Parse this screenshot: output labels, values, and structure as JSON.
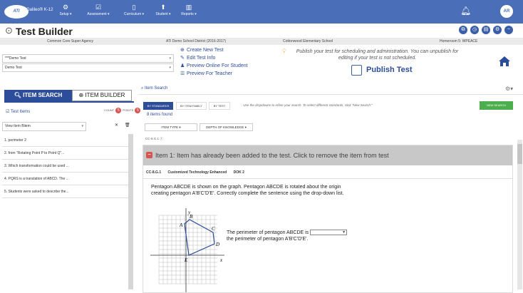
{
  "app": {
    "brand": "Galileo® K-12",
    "logo_text": "ATI",
    "nav": [
      {
        "label": "Setup ▾",
        "icon": "gear-icon",
        "glyph": "⚙"
      },
      {
        "label": "Assessment ▾",
        "icon": "clipboard-icon",
        "glyph": "☑"
      },
      {
        "label": "Curriculum ▾",
        "icon": "book-icon",
        "glyph": "▯"
      },
      {
        "label": "Student ▾",
        "icon": "student-icon",
        "glyph": "⬆"
      },
      {
        "label": "Reports ▾",
        "icon": "bar-chart-icon",
        "glyph": "▥"
      }
    ],
    "avatar": "AR",
    "accent": "#4a6eb8"
  },
  "page": {
    "title": "Test Builder",
    "header_icons": [
      "copy-icon",
      "history-icon",
      "print-icon",
      "settings-icon",
      "close-icon"
    ]
  },
  "context": {
    "agency": "Common Core Super Agency",
    "district": "ATI Demo School District (2016-2017)",
    "school": "Cottonwood Elementary School",
    "homeroom": "Homeroom 5: WPEACE"
  },
  "test": {
    "select1": "***Demo Test",
    "select2": "Demo Test",
    "actions": [
      {
        "label": "Create New Test",
        "glyph": "⊕"
      },
      {
        "label": "Edit Test Info",
        "glyph": "✎"
      },
      {
        "label": "Preview Online For Student",
        "glyph": "♟"
      },
      {
        "label": "Preview For Teacher",
        "glyph": "☰"
      }
    ],
    "publish_hint": "Publish your test for scheduling and administration. You can unpublish for editing if your test is not scheduled.",
    "publish_label": "Publish Test"
  },
  "left": {
    "tab_search": "ITEM SEARCH",
    "tab_builder": "ITEM BUILDER",
    "test_items_label": "Test Items",
    "count_label": "COUNT",
    "count_value": "5",
    "points_label": "POINTS",
    "points_value": "5",
    "view_item": "View Item Bliem",
    "items": [
      "1.  perimeter 2",
      "2.  from \"Rotating Point P to Point Q\"...",
      "3.  Which transformation could be used ...",
      "4.  PQRS is a translation of ABCD. The ...",
      "5.  Students were asked to describe the..."
    ]
  },
  "right": {
    "search_label": "Item Search",
    "tabs": [
      "BY STANDARDS",
      "BY ITEM FAMILY",
      "BY TEST"
    ],
    "hint": "Use the dropdowns to refine your search. To select different standards, click \"New Search.\"",
    "new_search": "NEW SEARCH",
    "items_found": "8 items found",
    "dd_type": "ITEM TYPE ▾",
    "dd_dok": "DEPTH OF KNOWLEDGE ▾",
    "standard_chip": "CC-8.G.1 ⓧ"
  },
  "item": {
    "banner": "Item 1:  Item has already been added to the test. Click to remove the item from test",
    "meta": [
      "CC-8.G.1",
      "Customized Technology Enhanced",
      "DOK 2"
    ],
    "prompt": "Pentagon ABCDE is shown on the graph. Pentagon ABCDE is rotated about the origin creating pentagon A'B'C'D'E'. Correctly complete the sentence using the drop-down list.",
    "answer_pre": "The perimeter of pentagon ABCDE is",
    "answer_post": "the perimeter of pentagon A'B'C'D'E'.",
    "graph_labels": {
      "y": "y",
      "x": "x",
      "A": "A",
      "B": "B",
      "C": "C",
      "D": "D",
      "E": "E"
    }
  }
}
